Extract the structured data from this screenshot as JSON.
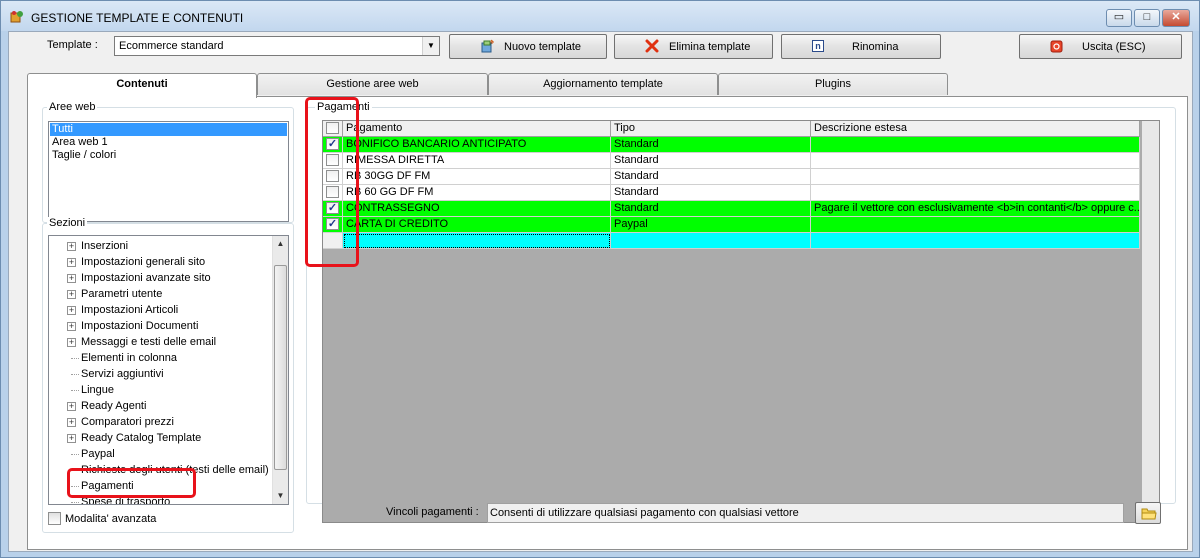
{
  "window": {
    "title": "GESTIONE TEMPLATE E CONTENUTI",
    "controls": {
      "minimize": "▭",
      "maximize": "□",
      "close": "✕"
    }
  },
  "toolbar": {
    "template_label": "Template :",
    "template_value": "Ecommerce standard",
    "new_label": "Nuovo template",
    "delete_label": "Elimina template",
    "rename_label": "Rinomina",
    "exit_label": "Uscita (ESC)",
    "rename_icon_glyph": "n"
  },
  "tabs": [
    {
      "label": "Contenuti"
    },
    {
      "label": "Gestione aree web"
    },
    {
      "label": "Aggiornamento template"
    },
    {
      "label": "Plugins"
    }
  ],
  "aree_web": {
    "title": "Aree web",
    "items": [
      "Tutti",
      "Area web 1",
      "Taglie / colori"
    ],
    "selected_index": 0
  },
  "sezioni": {
    "title": "Sezioni",
    "items": [
      {
        "label": "Inserzioni",
        "expandable": true
      },
      {
        "label": "Impostazioni generali sito",
        "expandable": true
      },
      {
        "label": "Impostazioni avanzate sito",
        "expandable": true
      },
      {
        "label": "Parametri utente",
        "expandable": true
      },
      {
        "label": "Impostazioni Articoli",
        "expandable": true
      },
      {
        "label": "Impostazioni Documenti",
        "expandable": true
      },
      {
        "label": "Messaggi e testi delle email",
        "expandable": true
      },
      {
        "label": "Elementi in colonna",
        "expandable": false
      },
      {
        "label": "Servizi aggiuntivi",
        "expandable": false
      },
      {
        "label": "Lingue",
        "expandable": false
      },
      {
        "label": "Ready Agenti",
        "expandable": true
      },
      {
        "label": "Comparatori prezzi",
        "expandable": true
      },
      {
        "label": "Ready Catalog Template",
        "expandable": true
      },
      {
        "label": "Paypal",
        "expandable": false
      },
      {
        "label": "Richieste degli utenti (testi delle email)",
        "expandable": false
      },
      {
        "label": "Pagamenti",
        "expandable": false
      },
      {
        "label": "Spese di trasporto",
        "expandable": false
      }
    ],
    "expand_glyph": "+"
  },
  "modalita_label": "Modalita' avanzata",
  "pagamenti": {
    "title": "Pagamenti",
    "columns": [
      "Pagamento",
      "Tipo",
      "Descrizione estesa"
    ],
    "rows": [
      {
        "checked": true,
        "pagamento": "BONIFICO BANCARIO ANTICIPATO",
        "tipo": "Standard",
        "descrizione": "",
        "color": "green"
      },
      {
        "checked": false,
        "pagamento": "RIMESSA DIRETTA",
        "tipo": "Standard",
        "descrizione": "",
        "color": "white"
      },
      {
        "checked": false,
        "pagamento": "RB 30GG DF FM",
        "tipo": "Standard",
        "descrizione": "",
        "color": "white"
      },
      {
        "checked": false,
        "pagamento": "RB 60 GG DF FM",
        "tipo": "Standard",
        "descrizione": "",
        "color": "white"
      },
      {
        "checked": true,
        "pagamento": "CONTRASSEGNO",
        "tipo": "Standard",
        "descrizione": "Pagare il vettore con esclusivamente <b>in contanti</b> oppure c...",
        "color": "green"
      },
      {
        "checked": true,
        "pagamento": "CARTA DI CREDITO",
        "tipo": "Paypal",
        "descrizione": "",
        "color": "green"
      }
    ],
    "check_glyph": "✓"
  },
  "vincoli": {
    "label": "Vincoli pagamenti :",
    "value": "Consenti di utilizzare qualsiasi pagamento con qualsiasi vettore"
  },
  "colors": {
    "row_green": "#00ff00",
    "row_cyan": "#00ffff",
    "highlight_red": "#e8121a",
    "selection_blue": "#3399ff"
  },
  "icons": {
    "app": "app-icon",
    "new": "new-template-icon",
    "delete": "delete-icon",
    "rename": "rename-icon",
    "exit": "exit-icon",
    "folder": "folder-icon"
  }
}
